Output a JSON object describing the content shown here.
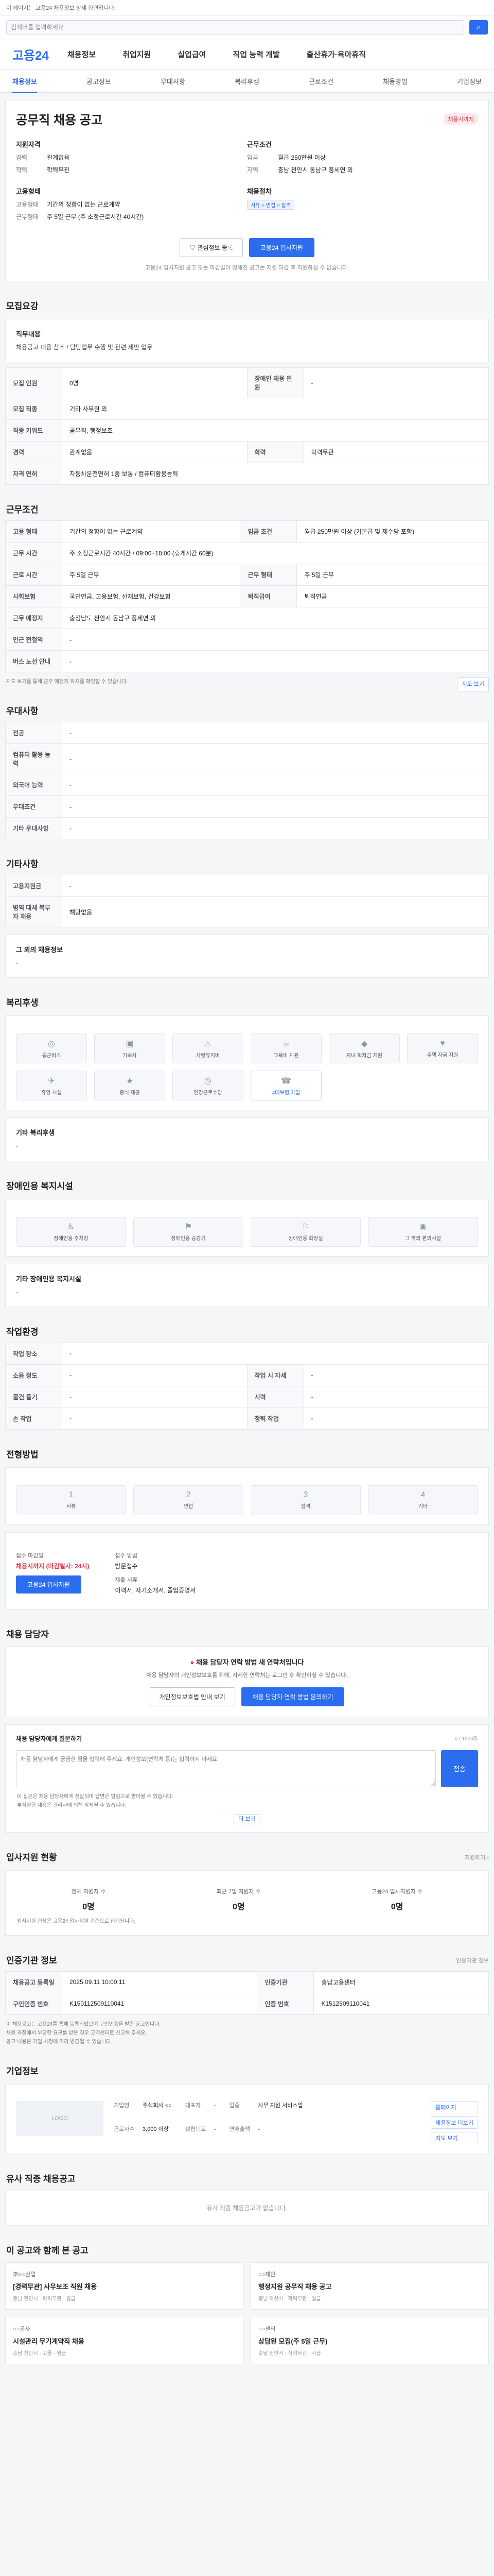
{
  "topbar": {
    "notice": "이 페이지는 고용24 채용정보 상세 화면입니다."
  },
  "search": {
    "placeholder": "검색어를 입력하세요",
    "button": "검색"
  },
  "gnb": {
    "logo": "고용24",
    "menus": [
      "채용정보",
      "취업지원",
      "실업급여",
      "직업 능력 개발",
      "출산휴가·육아휴직"
    ]
  },
  "subnav": {
    "items": [
      "채용정보",
      "공고정보",
      "우대사항",
      "복리후생",
      "근로조건",
      "채용방법",
      "기업정보"
    ]
  },
  "job": {
    "title": "공무직 채용 공고",
    "badge": "채용시까지",
    "recruit_title": "지원자격",
    "recruit_rows": [
      {
        "k": "경력",
        "v": "관계없음"
      },
      {
        "k": "학력",
        "v": "학력무관"
      }
    ],
    "cond_title": "근무조건",
    "cond_rows": [
      {
        "k": "임금",
        "v": "월급 250만원 이상"
      },
      {
        "k": "지역",
        "v": "충남 천안시 동남구 풍세면 외"
      }
    ],
    "form_title": "고용형태",
    "form_rows": [
      {
        "k": "고용형태",
        "v": "기간의 정함이 없는 근로계약"
      },
      {
        "k": "근무형태",
        "v": "주 5일 근무 (주 소정근로시간 40시간)"
      }
    ],
    "process_title": "채용절차",
    "process_chip": "서류 > 면접 > 합격",
    "btn_scrap": "관심정보 등록",
    "btn_apply": "고용24 입사지원",
    "note": "고용24 입사지원 공고 또는 마감일이 정해진 공고는 지원 마감 후 지원하실 수 없습니다."
  },
  "sec_recruit": "모집요강",
  "duty": {
    "h": "직무내용",
    "t": "채용공고 내용 참조 / 담당업무 수행 및 관련 제반 업무"
  },
  "recruit_table": [
    {
      "k1": "모집 인원",
      "v1": "0명",
      "k2": "장애인 채용 인원",
      "v2": "-"
    },
    {
      "k1": "모집 직종",
      "v1": "기타 사무원 외",
      "k2": "",
      "v2": ""
    },
    {
      "k1": "직종 키워드",
      "v1": "공무직, 행정보조",
      "k2": "",
      "v2": ""
    },
    {
      "k1": "경력",
      "v1": "관계없음",
      "k2": "학력",
      "v2": "학력무관"
    },
    {
      "k1": "자격 면허",
      "v1": "자동차운전면허 1종 보통 / 컴퓨터활용능력",
      "k2": "",
      "v2": ""
    }
  ],
  "sec_work": "근무조건",
  "work_table": [
    {
      "k1": "고용 형태",
      "v1": "기간의 정함이 없는 근로계약",
      "k2": "임금 조건",
      "v2": "월급 250만원 이상 (기본급 및 제수당 포함)"
    },
    {
      "k1": "근무 시간",
      "v1": "주 소정근로시간 40시간 / 09:00~18:00 (휴게시간 60분)",
      "k2": "",
      "v2": ""
    },
    {
      "k1": "근로 시간",
      "v1": "주 5일 근무",
      "k2": "근무 형태",
      "v2": "주 5일 근무"
    },
    {
      "k1": "사회보험",
      "v1": "국민연금, 고용보험, 산재보험, 건강보험",
      "k2": "퇴직급여",
      "v2": "퇴직연금"
    },
    {
      "k1": "근무 예정지",
      "v1": "충청남도 천안시 동남구 풍세면 외",
      "k2": "",
      "v2": ""
    },
    {
      "k1": "인근 전철역",
      "v1": "-",
      "k2": "",
      "v2": ""
    },
    {
      "k1": "버스 노선 안내",
      "v1": "-",
      "k2": "",
      "v2": ""
    }
  ],
  "work_note": "지도 보기를 통해 근무 예정지 위치를 확인할 수 있습니다.",
  "map_btn": "지도 보기",
  "sec_pref": "우대사항",
  "pref_table": [
    {
      "k": "전공",
      "v": "-"
    },
    {
      "k": "컴퓨터 활용 능력",
      "v": "-"
    },
    {
      "k": "외국어 능력",
      "v": "-"
    },
    {
      "k": "우대조건",
      "v": "-"
    },
    {
      "k": "기타 우대사항",
      "v": "-"
    }
  ],
  "sec_etc": "기타사항",
  "etc_table": [
    {
      "k": "고용지원금",
      "v": "-"
    },
    {
      "k": "병역 대체 복무자 채용",
      "v": "해당없음"
    }
  ],
  "etc_extra": {
    "h": "그 외의 채용정보",
    "t": "-"
  },
  "sec_welfare": "복리후생",
  "welfare_icons": [
    {
      "g": "◎",
      "t": "통근버스"
    },
    {
      "g": "▣",
      "t": "기숙사"
    },
    {
      "g": "♨",
      "t": "차량유지비"
    },
    {
      "g": "☕",
      "t": "교육비 지원"
    },
    {
      "g": "◆",
      "t": "자녀 학자금 지원"
    },
    {
      "g": "♥",
      "t": "주택 자금 지원"
    },
    {
      "g": "✈",
      "t": "휴양 시설"
    },
    {
      "g": "★",
      "t": "중식 제공"
    },
    {
      "g": "◷",
      "t": "연장근로수당"
    },
    {
      "g": "☎",
      "t": "4대보험 가입"
    }
  ],
  "welfare_other": {
    "h": "기타 복리후생",
    "t": "-"
  },
  "sec_disability": "장애인용 복지시설",
  "disability_icons": [
    {
      "g": "♿",
      "t": "장애인용 주차장"
    },
    {
      "g": "⚑",
      "t": "장애인용 승강기"
    },
    {
      "g": "⚐",
      "t": "장애인용 화장실"
    },
    {
      "g": "◉",
      "t": "그 밖의 편의시설"
    }
  ],
  "disability_other": {
    "h": "기타 장애인용 복지시설",
    "t": "-"
  },
  "sec_env": "작업환경",
  "env_table": [
    {
      "k1": "작업 장소",
      "v1": "-",
      "k2": "",
      "v2": ""
    },
    {
      "k1": "소음 정도",
      "v1": "-",
      "k2": "작업 시 자세",
      "v2": "-"
    },
    {
      "k1": "물건 들기",
      "v1": "-",
      "k2": "시력",
      "v2": "-"
    },
    {
      "k1": "손 작업",
      "v1": "-",
      "k2": "청력 작업",
      "v2": "-"
    }
  ],
  "sec_method": "전형방법",
  "method_steps": [
    {
      "n": "1",
      "t": "서류"
    },
    {
      "n": "2",
      "t": "면접"
    },
    {
      "n": "3",
      "t": "합격"
    },
    {
      "n": "4",
      "t": "기타"
    }
  ],
  "apply": {
    "k1": "접수 마감일",
    "v1": "채용시까지 (마감일시: 24시)",
    "k2": "접수 방법",
    "v2": "방문접수",
    "k3": "제출 서류",
    "v3": "이력서, 자기소개서, 졸업증명서",
    "btn": "고용24 입사지원"
  },
  "sec_contact": "채용 담당자",
  "contact": {
    "warn": "채용 담당자 연락 방법 새 연락처입니다",
    "desc": "채용 담당자의 개인정보보호를 위해, 자세한 연락처는 로그인 후 확인하실 수 있습니다.",
    "btn1": "개인정보보호법 안내 보기",
    "btn2": "채용 담당자 연락 방법 문의하기"
  },
  "inquiry": {
    "h": "채용 담당자에게 질문하기",
    "count": "0 / 1000자",
    "placeholder": "채용 담당자에게 궁금한 점을 입력해 주세요. 개인정보(연락처 등)는 입력하지 마세요.",
    "send": "전송"
  },
  "inquiry_bullets": [
    "이 질문은 채용 담당자에게 전달되며 답변은 알림으로 받아볼 수 있습니다.",
    "부적절한 내용은 관리자에 의해 삭제될 수 있습니다."
  ],
  "inquiry_more": "더 보기",
  "sec_status": "입사지원 현황",
  "status_link": "지원하기 ›",
  "status": [
    {
      "k": "전체 지원자 수",
      "v": "0명"
    },
    {
      "k": "최근 7일 지원자 수",
      "v": "0명"
    },
    {
      "k": "고용24 입사지원자 수",
      "v": "0명"
    }
  ],
  "status_note": "입사지원 현황은 고용24 입사지원 기준으로 집계됩니다.",
  "sec_org": "인증기관 정보",
  "org_btn": "인증기관 정보",
  "org_table": [
    {
      "k1": "채용공고 등록일",
      "v1": "2025.09.11 10:00:11",
      "k2": "인증기관",
      "v2": "충남고용센터"
    },
    {
      "k1": "구인인증 번호",
      "v1": "K150112509110041",
      "k2": "인증 번호",
      "v2": "K1512509110041"
    }
  ],
  "org_bullets": [
    "이 채용공고는 고용24를 통해 등록되었으며 구인인증을 받은 공고입니다.",
    "채용 과정에서 부당한 요구를 받은 경우 고객센터로 신고해 주세요.",
    "공고 내용은 기업 사정에 따라 변경될 수 있습니다."
  ],
  "sec_company": "기업정보",
  "company": {
    "logo": "LOGO",
    "rows": [
      {
        "k": "기업명",
        "v": "주식회사 ○○"
      },
      {
        "k": "대표자",
        "v": "-"
      },
      {
        "k": "업종",
        "v": "사무 지원 서비스업"
      },
      {
        "k": "근로자수",
        "v": "3,000 이상"
      },
      {
        "k": "설립년도",
        "v": "-"
      },
      {
        "k": "연매출액",
        "v": "-"
      }
    ],
    "btn1": "홈페이지",
    "btn2": "채용정보 더보기",
    "btn3": "지도 보기"
  },
  "sec_similar": "유사 직종 채용공고",
  "similar_empty": "유사 직종 채용공고가 없습니다.",
  "sec_reco": "이 공고와 함께 본 공고",
  "reco": [
    {
      "co": "㈜○○산업",
      "tt": "[경력무관] 사무보조 직원 채용",
      "mt": "충남 천안시 · 학력무관 · 월급"
    },
    {
      "co": "○○재단",
      "tt": "행정지원 공무직 채용 공고",
      "mt": "충남 아산시 · 학력무관 · 월급"
    },
    {
      "co": "○○공사",
      "tt": "시설관리 무기계약직 채용",
      "mt": "충남 천안시 · 고졸 · 월급"
    },
    {
      "co": "○○센터",
      "tt": "상담원 모집(주 5일 근무)",
      "mt": "충남 천안시 · 학력무관 · 시급"
    }
  ],
  "colors": {
    "primary": "#2c6df0",
    "danger": "#e5364a"
  }
}
